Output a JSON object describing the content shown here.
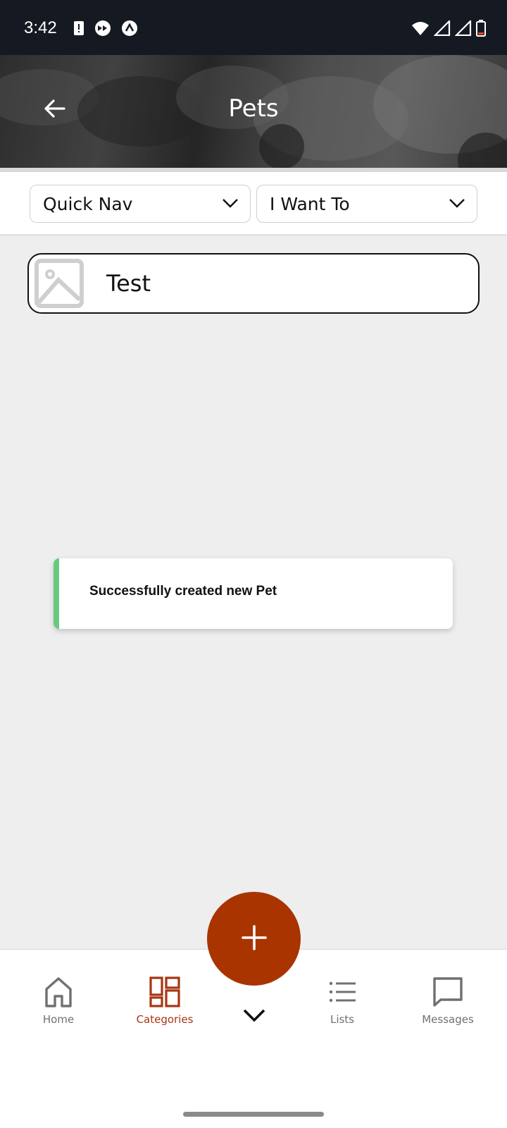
{
  "status_bar": {
    "time": "3:42",
    "left_icons": [
      "alert-icon",
      "fast-forward-icon",
      "chevron-up-badge-icon"
    ],
    "right_icons": [
      "wifi-icon",
      "signal-icon",
      "signal-icon",
      "battery-icon"
    ]
  },
  "header": {
    "title": "Pets",
    "back_icon": "arrow-left-icon"
  },
  "nav": {
    "quick_nav_label": "Quick Nav",
    "i_want_to_label": "I Want To"
  },
  "items": [
    {
      "label": "Test",
      "thumbnail_icon": "image-placeholder-icon"
    }
  ],
  "toast": {
    "message": "Successfully created new Pet",
    "accent_color": "#69c97b"
  },
  "bottom_nav": {
    "tabs": [
      {
        "label": "Home",
        "icon": "home-icon",
        "active": false
      },
      {
        "label": "Categories",
        "icon": "categories-icon",
        "active": true
      },
      {
        "label": "Lists",
        "icon": "list-icon",
        "active": false
      },
      {
        "label": "Messages",
        "icon": "message-icon",
        "active": false
      }
    ],
    "fab_icon": "plus-icon",
    "center_icon": "chevron-down-icon"
  },
  "colors": {
    "brand": "#a93400",
    "active_tab": "#a73612",
    "inactive_tab": "#707070"
  }
}
